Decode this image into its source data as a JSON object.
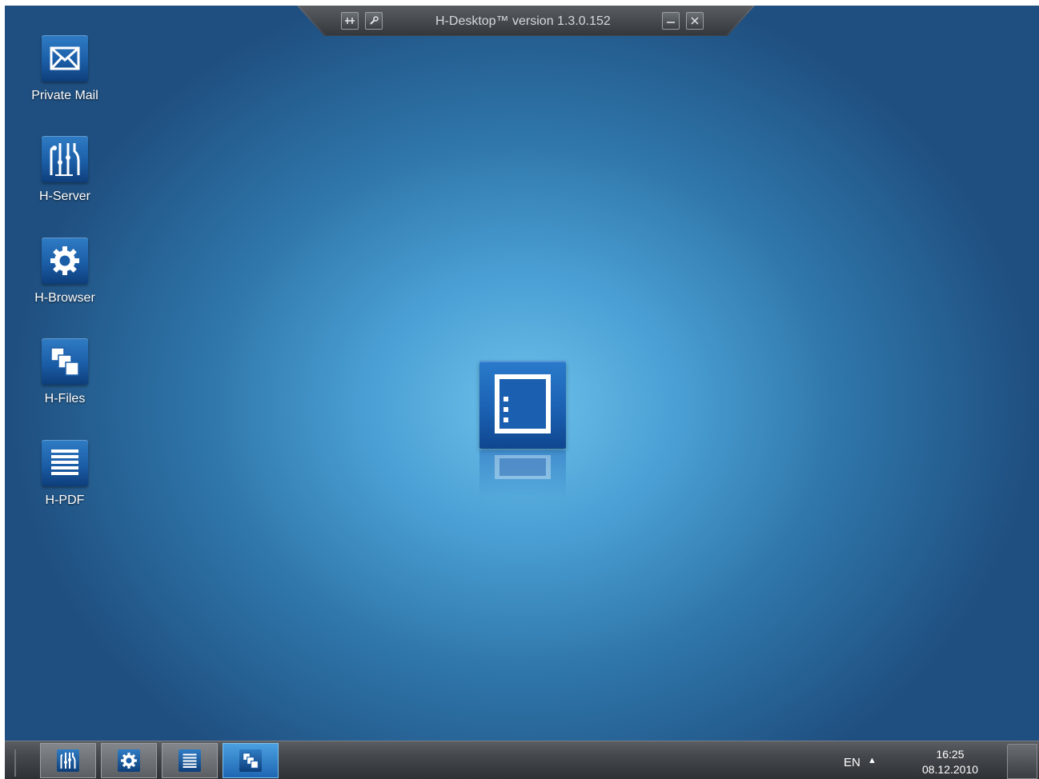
{
  "titlebar": {
    "title": "H-Desktop™  version 1.3.0.152",
    "buttons": [
      "pin-icon",
      "wrench-icon",
      "minimize-icon",
      "close-icon"
    ]
  },
  "desktop": {
    "icons": [
      {
        "label": "Private Mail",
        "icon": "mail-icon"
      },
      {
        "label": "H-Server",
        "icon": "server-icon"
      },
      {
        "label": "H-Browser",
        "icon": "gear-icon"
      },
      {
        "label": "H-Files",
        "icon": "files-icon"
      },
      {
        "label": "H-PDF",
        "icon": "document-lines-icon"
      }
    ],
    "center_logo": "app-window-icon"
  },
  "taskbar": {
    "apps": [
      {
        "icon": "server-icon",
        "active": false
      },
      {
        "icon": "gear-icon",
        "active": false
      },
      {
        "icon": "document-lines-icon",
        "active": false
      },
      {
        "icon": "files-icon",
        "active": true
      }
    ],
    "language": "EN",
    "language_arrow": "▲",
    "time": "16:25",
    "date": "08.12.2010"
  },
  "colors": {
    "desktop_center": "#6cc0ea",
    "desktop_edge": "#1f4f80",
    "tile_blue": "#1b5ea8",
    "taskbar": "#44484c",
    "active_task": "#3a8ad0"
  }
}
